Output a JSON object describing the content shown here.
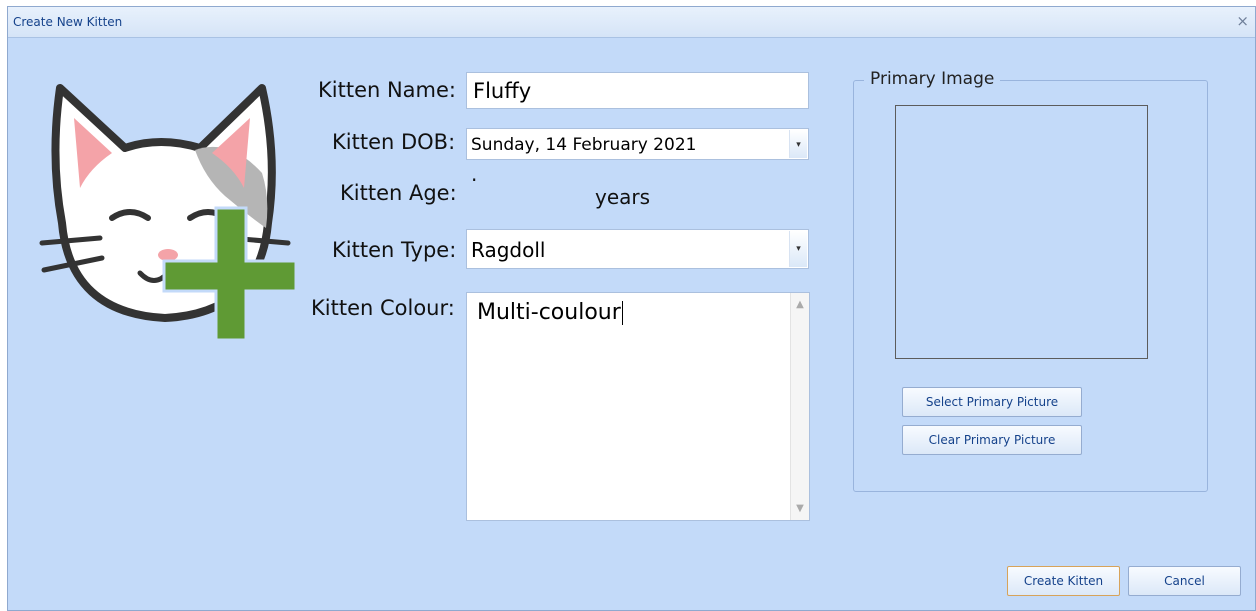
{
  "window": {
    "title": "Create New Kitten",
    "close_glyph": "×"
  },
  "icons": {
    "logo": "kitten-add-icon",
    "close": "close-icon",
    "dropdown": "chevron-down-icon"
  },
  "form": {
    "name_label": "Kitten Name:",
    "name_value": "Fluffy",
    "dob_label": "Kitten DOB:",
    "dob_value": "Sunday, 14 February 2021",
    "age_label": "Kitten Age:",
    "age_value": ".",
    "age_unit": "years",
    "type_label": "Kitten Type:",
    "type_value": "Ragdoll",
    "colour_label": "Kitten Colour:",
    "colour_value": "Multi-coulour"
  },
  "image_group": {
    "title": "Primary Image",
    "select_button": "Select Primary Picture",
    "clear_button": "Clear Primary Picture"
  },
  "footer": {
    "create_button": "Create Kitten",
    "cancel_button": "Cancel"
  },
  "colors": {
    "window_bg": "#c3daf9",
    "title_text": "#15428b",
    "plus_green": "#5f9a34",
    "ear_pink": "#f4a3a8",
    "patch_grey": "#b5b5b5"
  }
}
